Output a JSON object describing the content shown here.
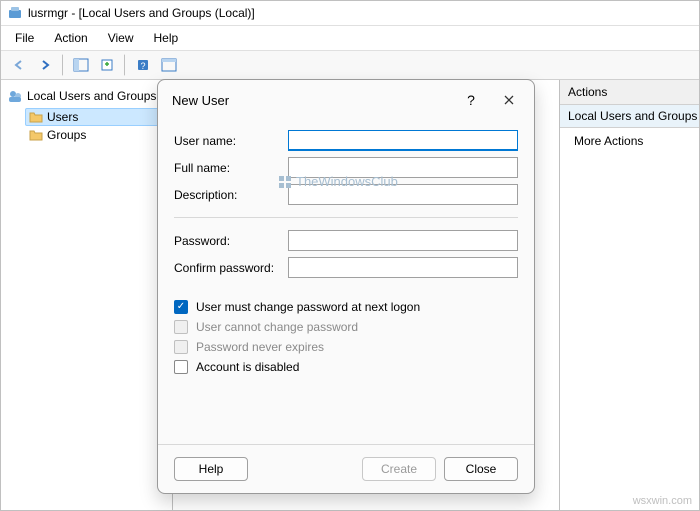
{
  "window": {
    "title": "lusrmgr - [Local Users and Groups (Local)]"
  },
  "menu": {
    "file": "File",
    "action": "Action",
    "view": "View",
    "help": "Help"
  },
  "tree": {
    "root": "Local Users and Groups",
    "users": "Users",
    "groups": "Groups"
  },
  "actions": {
    "header": "Actions",
    "subheader": "Local Users and Groups",
    "more": "More Actions"
  },
  "dialog": {
    "title": "New User",
    "labels": {
      "username": "User name:",
      "fullname": "Full name:",
      "description": "Description:",
      "password": "Password:",
      "confirm": "Confirm password:"
    },
    "values": {
      "username": "",
      "fullname": "",
      "description": "",
      "password": "",
      "confirm": ""
    },
    "checks": {
      "mustchange": "User must change password at next logon",
      "cannotchange": "User cannot change password",
      "neverexpires": "Password never expires",
      "disabled": "Account is disabled"
    },
    "buttons": {
      "help": "Help",
      "create": "Create",
      "close": "Close"
    }
  },
  "watermark": "TheWindowsClub",
  "site": "wsxwin.com"
}
